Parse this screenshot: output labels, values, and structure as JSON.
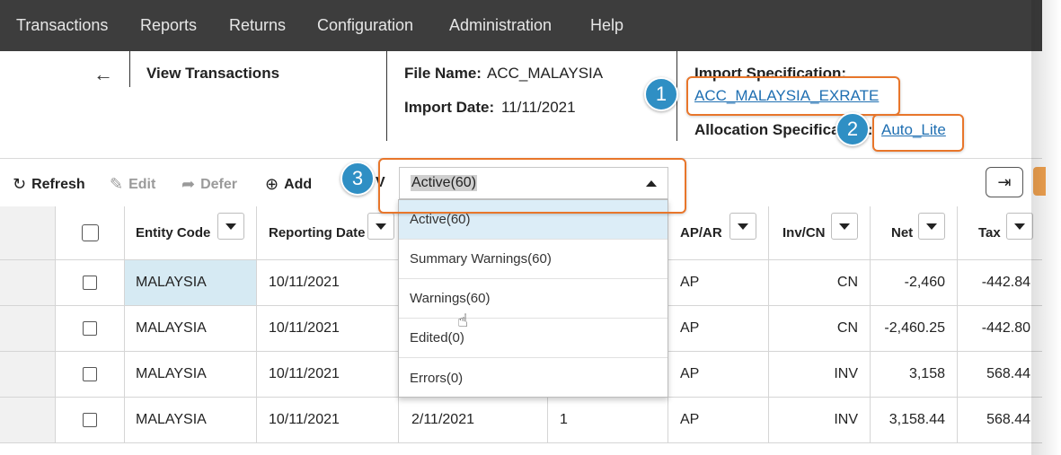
{
  "nav": {
    "items": [
      "Transactions",
      "Reports",
      "Returns",
      "Configuration",
      "Administration",
      "Help"
    ]
  },
  "header": {
    "back_icon": "←",
    "page_title": "View Transactions",
    "file_name_label": "File Name:",
    "file_name_value": "ACC_MALAYSIA",
    "import_date_label": "Import Date:",
    "import_date_value": "11/11/2021",
    "import_spec_label": "Import Specification:",
    "import_spec_value": "ACC_MALAYSIA_EXRATE",
    "alloc_spec_label": "Allocation Specification:",
    "alloc_spec_value": "Auto_Lite"
  },
  "callouts": [
    "1",
    "2",
    "3"
  ],
  "toolbar": {
    "refresh": "Refresh",
    "edit": "Edit",
    "defer": "Defer",
    "add": "Add",
    "hidden_label_fragment": "V",
    "filter_value": "Active(60)"
  },
  "filter_options": [
    "Active(60)",
    "Summary Warnings(60)",
    "Warnings(60)",
    "Edited(0)",
    "Errors(0)"
  ],
  "table": {
    "columns": [
      "Entity Code",
      "Reporting Date",
      "AP/AR",
      "Inv/CN",
      "Net",
      "Tax"
    ],
    "rows": [
      {
        "entity": "MALAYSIA",
        "reporting_date": "10/11/2021",
        "col3": "",
        "col4": "",
        "apar": "AP",
        "invcn": "CN",
        "net": "-2,460",
        "tax": "-442.84"
      },
      {
        "entity": "MALAYSIA",
        "reporting_date": "10/11/2021",
        "col3": "",
        "col4": "",
        "apar": "AP",
        "invcn": "CN",
        "net": "-2,460.25",
        "tax": "-442.80"
      },
      {
        "entity": "MALAYSIA",
        "reporting_date": "10/11/2021",
        "col3": "",
        "col4": "",
        "apar": "AP",
        "invcn": "INV",
        "net": "3,158",
        "tax": "568.44"
      },
      {
        "entity": "MALAYSIA",
        "reporting_date": "10/11/2021",
        "col3": "2/11/2021",
        "col4": "1",
        "apar": "AP",
        "invcn": "INV",
        "net": "3,158.44",
        "tax": "568.44"
      }
    ]
  },
  "colors": {
    "nav_bg": "#3d3d3d",
    "link": "#1f6fb2",
    "callout": "#e8762b",
    "badge": "#2f8fc4",
    "selected_row": "#dcedf7"
  }
}
